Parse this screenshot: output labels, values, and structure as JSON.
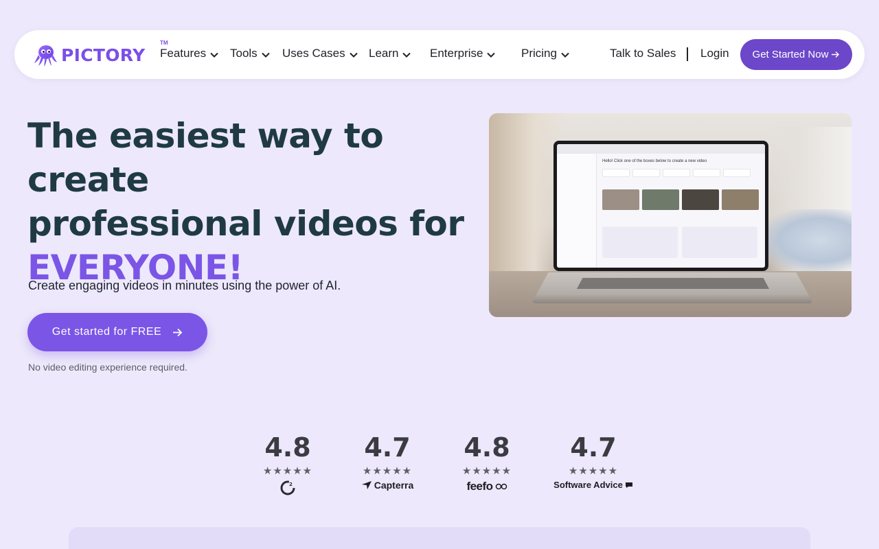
{
  "brand": {
    "name": "PICTORY",
    "tm": "TM",
    "accent": "#7b55e6",
    "button": "#6c47c9"
  },
  "nav": {
    "items": [
      {
        "label": "Features"
      },
      {
        "label": "Tools"
      },
      {
        "label": "Uses Cases"
      },
      {
        "label": "Learn"
      },
      {
        "label": "Enterprise"
      },
      {
        "label": "Pricing"
      }
    ],
    "talk_to_sales": "Talk to Sales",
    "login": "Login",
    "cta": "Get Started Now"
  },
  "hero": {
    "title_line1": "The easiest way to create",
    "title_line2": "professional videos for",
    "title_accent": "EVERYONE!",
    "subtitle": "Create engaging videos in minutes using the power of AI.",
    "cta": "Get started for FREE",
    "note": "No video editing experience required."
  },
  "hero_image": {
    "screen_greeting": "Hello! Click one of the boxes below to create a new video"
  },
  "ratings": [
    {
      "value": "4.8",
      "stars": "★★★★★",
      "brand": "G2",
      "icon": "g2-logo-icon"
    },
    {
      "value": "4.7",
      "stars": "★★★★★",
      "brand": "Capterra",
      "icon": "capterra-logo-icon"
    },
    {
      "value": "4.8",
      "stars": "★★★★★",
      "brand": "feefo",
      "icon": "feefo-logo-icon"
    },
    {
      "value": "4.7",
      "stars": "★★★★★",
      "brand": "Software Advice",
      "icon": "software-advice-logo-icon"
    }
  ]
}
